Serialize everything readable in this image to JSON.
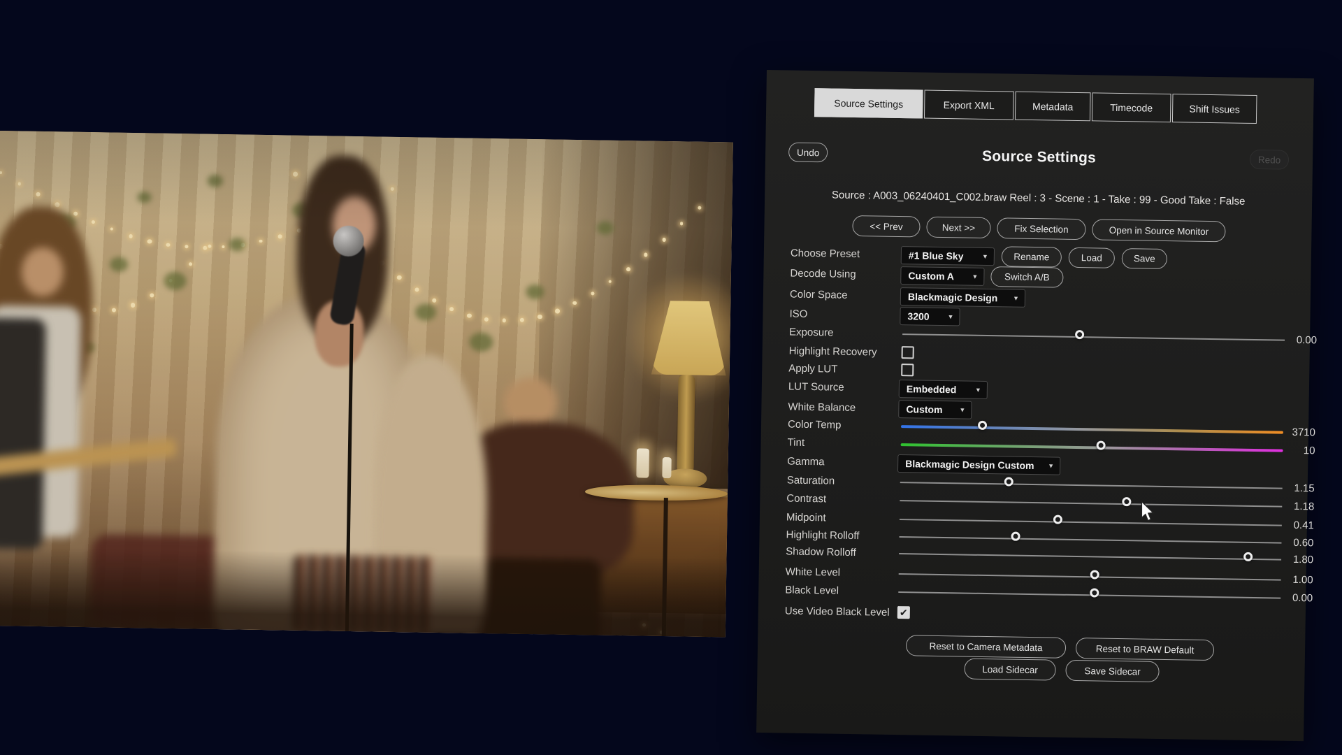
{
  "tabs": [
    {
      "label": "Source Settings",
      "active": true
    },
    {
      "label": "Export XML",
      "active": false
    },
    {
      "label": "Metadata",
      "active": false
    },
    {
      "label": "Timecode",
      "active": false
    },
    {
      "label": "Shift Issues",
      "active": false
    }
  ],
  "header": {
    "undo_label": "Undo",
    "redo_label": "Redo",
    "title": "Source Settings"
  },
  "source_info": "Source : A003_06240401_C002.braw   Reel : 3 - Scene : 1 - Take : 99 - Good Take : False",
  "nav_buttons": [
    {
      "label": "<< Prev"
    },
    {
      "label": "Next >>"
    },
    {
      "label": "Fix Selection"
    },
    {
      "label": "Open in Source Monitor"
    }
  ],
  "settings_rows": [
    {
      "label": "Choose Preset",
      "type": "dropdown",
      "value": "#1 Blue Sky",
      "buttons": [
        {
          "label": "Rename"
        },
        {
          "label": "Load"
        },
        {
          "label": "Save"
        }
      ]
    },
    {
      "label": "Decode Using",
      "type": "dropdown",
      "value": "Custom A",
      "buttons": [
        {
          "label": "Switch A/B"
        }
      ]
    },
    {
      "label": "Color Space",
      "type": "dropdown",
      "value": "Blackmagic Design"
    },
    {
      "label": "ISO",
      "type": "dropdown",
      "value": "3200"
    },
    {
      "label": "Exposure",
      "type": "slider",
      "value": "0.00",
      "fraction": 0.47,
      "gradient": "none"
    },
    {
      "label": "Highlight Recovery",
      "type": "checkbox",
      "checked": false
    },
    {
      "label": "Apply LUT",
      "type": "checkbox",
      "checked": false
    },
    {
      "label": "LUT Source",
      "type": "dropdown",
      "value": "Embedded"
    },
    {
      "label": "White Balance",
      "type": "dropdown",
      "value": "Custom"
    },
    {
      "label": "Color Temp",
      "type": "slider",
      "value": "3710",
      "fraction": 0.22,
      "gradient": "temp"
    },
    {
      "label": "Tint",
      "type": "slider",
      "value": "10",
      "fraction": 0.53,
      "gradient": "tint"
    },
    {
      "label": "Gamma",
      "type": "dropdown",
      "value": "Blackmagic Design Custom"
    },
    {
      "label": "Saturation",
      "type": "slider",
      "value": "1.15",
      "fraction": 0.29,
      "gradient": "none"
    },
    {
      "label": "Contrast",
      "type": "slider",
      "value": "1.18",
      "fraction": 0.6,
      "gradient": "none"
    },
    {
      "label": "Midpoint",
      "type": "slider",
      "value": "0.41",
      "fraction": 0.42,
      "gradient": "none"
    },
    {
      "label": "Highlight Rolloff",
      "type": "slider",
      "value": "0.60",
      "fraction": 0.31,
      "gradient": "none"
    },
    {
      "label": "Shadow Rolloff",
      "type": "slider",
      "value": "1.80",
      "fraction": 0.92,
      "gradient": "none"
    },
    {
      "label": "White Level",
      "type": "slider",
      "value": "1.00",
      "fraction": 0.52,
      "gradient": "none"
    },
    {
      "label": "Black Level",
      "type": "slider",
      "value": "0.00",
      "fraction": 0.52,
      "gradient": "none"
    },
    {
      "label": "Use Video Black Level",
      "type": "checkbox",
      "checked": true
    }
  ],
  "checkbox_check_glyph": "✔",
  "dropdown_caret_glyph": "▼",
  "footer_rows": [
    {
      "buttons": [
        {
          "label": "Reset to Camera Metadata"
        },
        {
          "label": "Reset to BRAW Default"
        }
      ]
    },
    {
      "buttons": [
        {
          "label": "Load Sidecar"
        },
        {
          "label": "Save Sidecar"
        }
      ]
    }
  ],
  "colors": {
    "panel_bg": "#1e1e1d",
    "tab_active_bg": "#d9d9d9",
    "temp_slider_left": "#3273e8",
    "temp_slider_right": "#ef8d24",
    "tint_slider_left": "#2fc22f",
    "tint_slider_right": "#e030e0",
    "background_navy": "#050a23"
  }
}
